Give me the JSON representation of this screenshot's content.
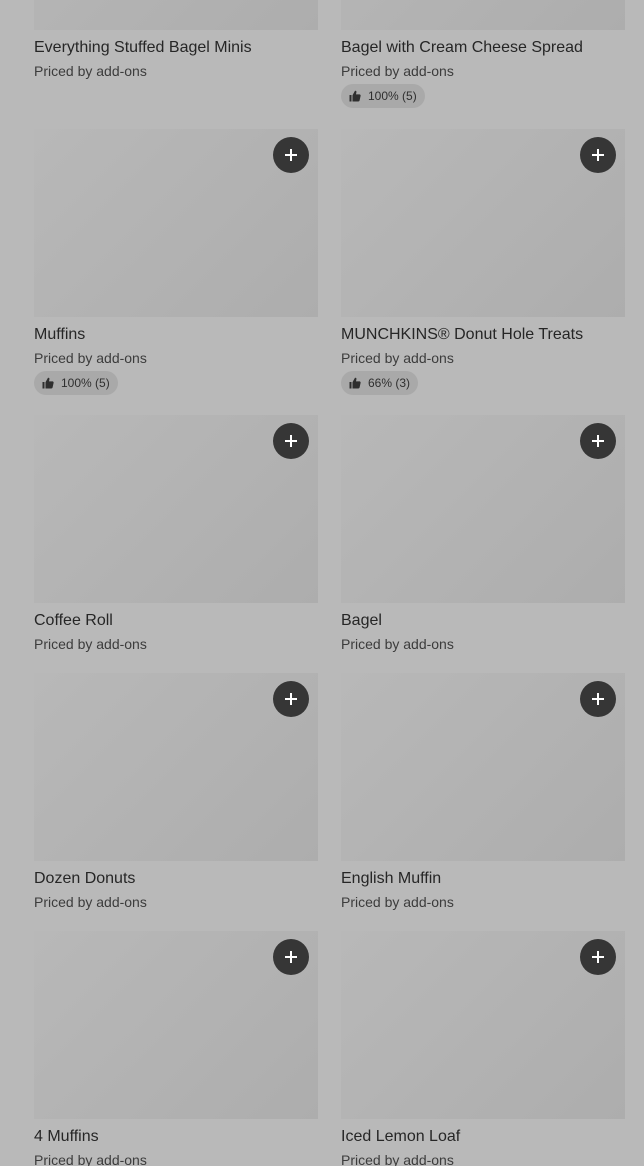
{
  "items": [
    {
      "name": "Everything Stuffed Bagel Minis",
      "price_text": "Priced by add-ons",
      "rating": ""
    },
    {
      "name": "Bagel with Cream Cheese Spread",
      "price_text": "Priced by add-ons",
      "rating": "100% (5)"
    },
    {
      "name": "Muffins",
      "price_text": "Priced by add-ons",
      "rating": "100% (5)"
    },
    {
      "name": "MUNCHKINS® Donut Hole Treats",
      "price_text": "Priced by add-ons",
      "rating": "66% (3)"
    },
    {
      "name": "Coffee Roll",
      "price_text": "Priced by add-ons",
      "rating": ""
    },
    {
      "name": "Bagel",
      "price_text": "Priced by add-ons",
      "rating": ""
    },
    {
      "name": "Dozen Donuts",
      "price_text": "Priced by add-ons",
      "rating": ""
    },
    {
      "name": "English Muffin",
      "price_text": "Priced by add-ons",
      "rating": ""
    },
    {
      "name": "4 Muffins",
      "price_text": "Priced by add-ons",
      "rating": ""
    },
    {
      "name": "Iced Lemon Loaf",
      "price_text": "Priced by add-ons",
      "rating": ""
    }
  ],
  "icons": {
    "add": "plus-icon",
    "rating": "thumbs-up-icon"
  },
  "colors": {
    "page_background": "#b9b9b9",
    "add_button": "#363636",
    "rating_pill": "#a9a9a9"
  }
}
